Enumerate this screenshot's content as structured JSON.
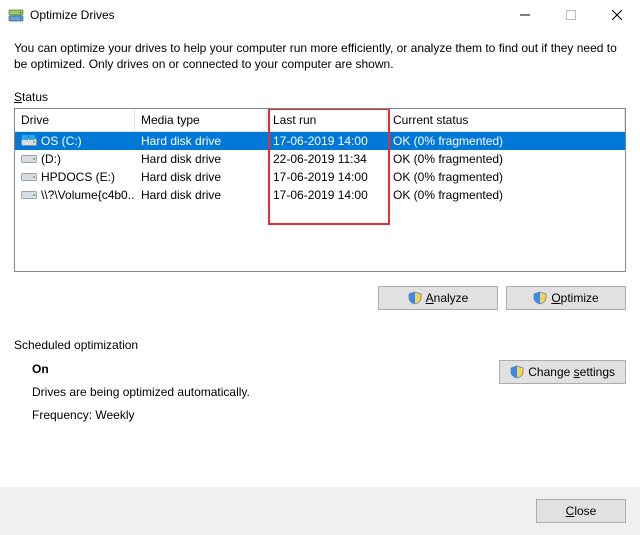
{
  "window": {
    "title": "Optimize Drives"
  },
  "intro": "You can optimize your drives to help your computer run more efficiently, or analyze them to find out if they need to be optimized. Only drives on or connected to your computer are shown.",
  "status_label_pre": "S",
  "status_label_post": "tatus",
  "columns": {
    "drive": "Drive",
    "media": "Media type",
    "last": "Last run",
    "status": "Current status"
  },
  "rows": [
    {
      "icon": "os",
      "name": "OS (C:)",
      "media": "Hard disk drive",
      "last": "17-06-2019 14:00",
      "status": "OK (0% fragmented)",
      "selected": true
    },
    {
      "icon": "hdd",
      "name": "(D:)",
      "media": "Hard disk drive",
      "last": "22-06-2019 11:34",
      "status": "OK (0% fragmented)",
      "selected": false
    },
    {
      "icon": "hdd",
      "name": "HPDOCS (E:)",
      "media": "Hard disk drive",
      "last": "17-06-2019 14:00",
      "status": "OK (0% fragmented)",
      "selected": false
    },
    {
      "icon": "hdd",
      "name": "\\\\?\\Volume{c4b0...",
      "media": "Hard disk drive",
      "last": "17-06-2019 14:00",
      "status": "OK (0% fragmented)",
      "selected": false
    }
  ],
  "buttons": {
    "analyze_pre": "A",
    "analyze_post": "nalyze",
    "optimize_pre": "O",
    "optimize_post": "ptimize",
    "change_pre": "Change ",
    "change_ul": "s",
    "change_post": "ettings",
    "close_pre": "C",
    "close_post": "lose"
  },
  "sched": {
    "header": "Scheduled optimization",
    "state": "On",
    "desc": "Drives are being optimized automatically.",
    "freq": "Frequency: Weekly"
  }
}
